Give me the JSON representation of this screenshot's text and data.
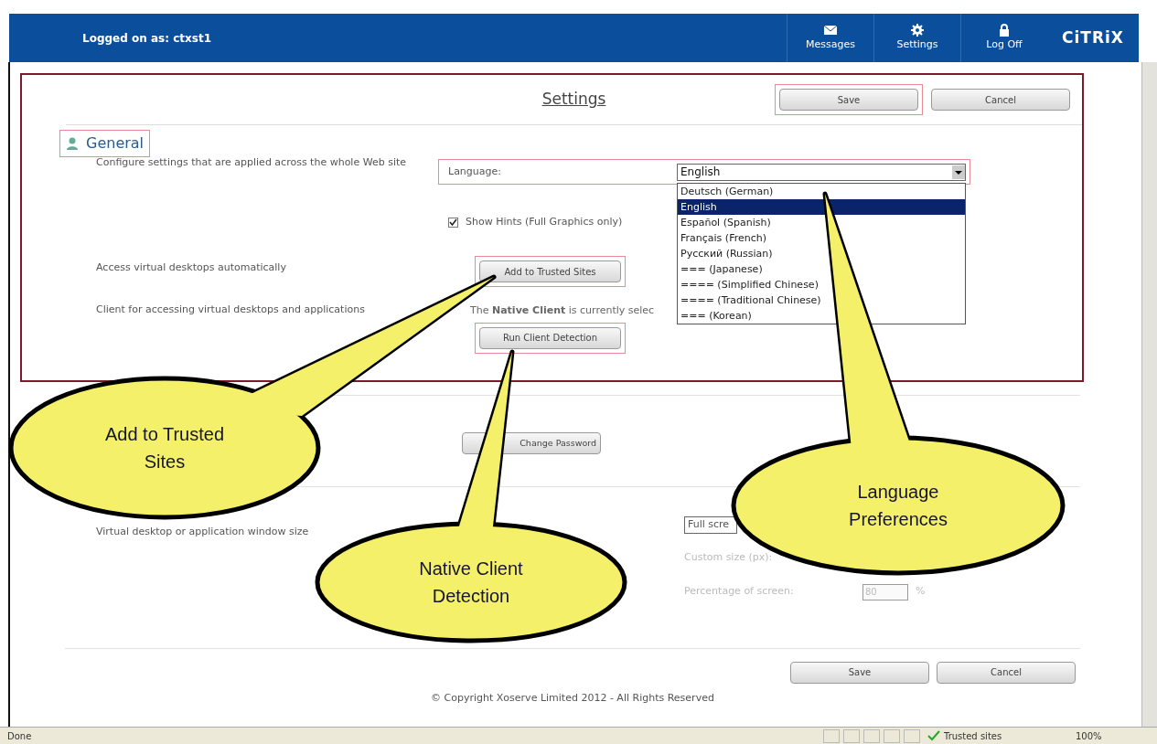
{
  "header": {
    "user_label": "Logged on as: ctxst1",
    "nav": [
      {
        "label": "Messages",
        "kind": "envelope"
      },
      {
        "label": "Settings",
        "kind": "gear"
      },
      {
        "label": "Log Off",
        "kind": "lock"
      }
    ],
    "logo": "CiTRiX"
  },
  "settings": {
    "title": "Settings",
    "top_buttons": [
      {
        "label": "Save",
        "highlighted": true
      },
      {
        "label": "Cancel",
        "highlighted": false
      }
    ],
    "general": {
      "heading": "General",
      "highlighted": true,
      "description": "Configure settings that are applied across the whole Web site",
      "language": {
        "label": "Language:",
        "value": "English",
        "highlighted": true,
        "options": [
          {
            "label": "Deutsch (German)",
            "selected": false
          },
          {
            "label": "English",
            "selected": true
          },
          {
            "label": "Español (Spanish)",
            "selected": false
          },
          {
            "label": "Français (French)",
            "selected": false
          },
          {
            "label": "Русский (Russian)",
            "selected": false
          },
          {
            "label": "=== (Japanese)",
            "selected": false
          },
          {
            "label": "==== (Simplified Chinese)",
            "selected": false
          },
          {
            "label": "==== (Traditional Chinese)",
            "selected": false
          },
          {
            "label": "=== (Korean)",
            "selected": false
          }
        ]
      },
      "show_hints": {
        "label": "Show Hints (Full Graphics only)",
        "checked": true
      },
      "rows": [
        {
          "description": "Access virtual desktops automatically",
          "button": "Add to Trusted Sites",
          "highlighted": true
        },
        {
          "description": "Client for accessing virtual desktops and applications",
          "status": "The **Native Client** is currently selec",
          "button": "Run Client Detection",
          "highlighted": true
        }
      ]
    },
    "password": {
      "button": "Change Password"
    },
    "display": {
      "description": "Virtual desktop or application window size",
      "select_value": "Full scre",
      "fields": [
        {
          "label": "Custom size (px):",
          "disabled": true
        },
        {
          "label": "Percentage of screen:",
          "value": "80",
          "unit": "%",
          "disabled": true
        }
      ]
    },
    "bottom_buttons": [
      {
        "label": "Save"
      },
      {
        "label": "Cancel"
      }
    ],
    "copyright": "© Copyright Xoserve Limited 2012 - All Rights Reserved"
  },
  "status_bar": {
    "text": "Done",
    "zone": "Trusted sites",
    "zoom": "100%"
  },
  "callouts": [
    {
      "lines": [
        "Add to Trusted",
        "Sites"
      ]
    },
    {
      "lines": [
        "Native Client",
        "Detection"
      ]
    },
    {
      "lines": [
        "Language",
        "Preferences"
      ]
    }
  ]
}
